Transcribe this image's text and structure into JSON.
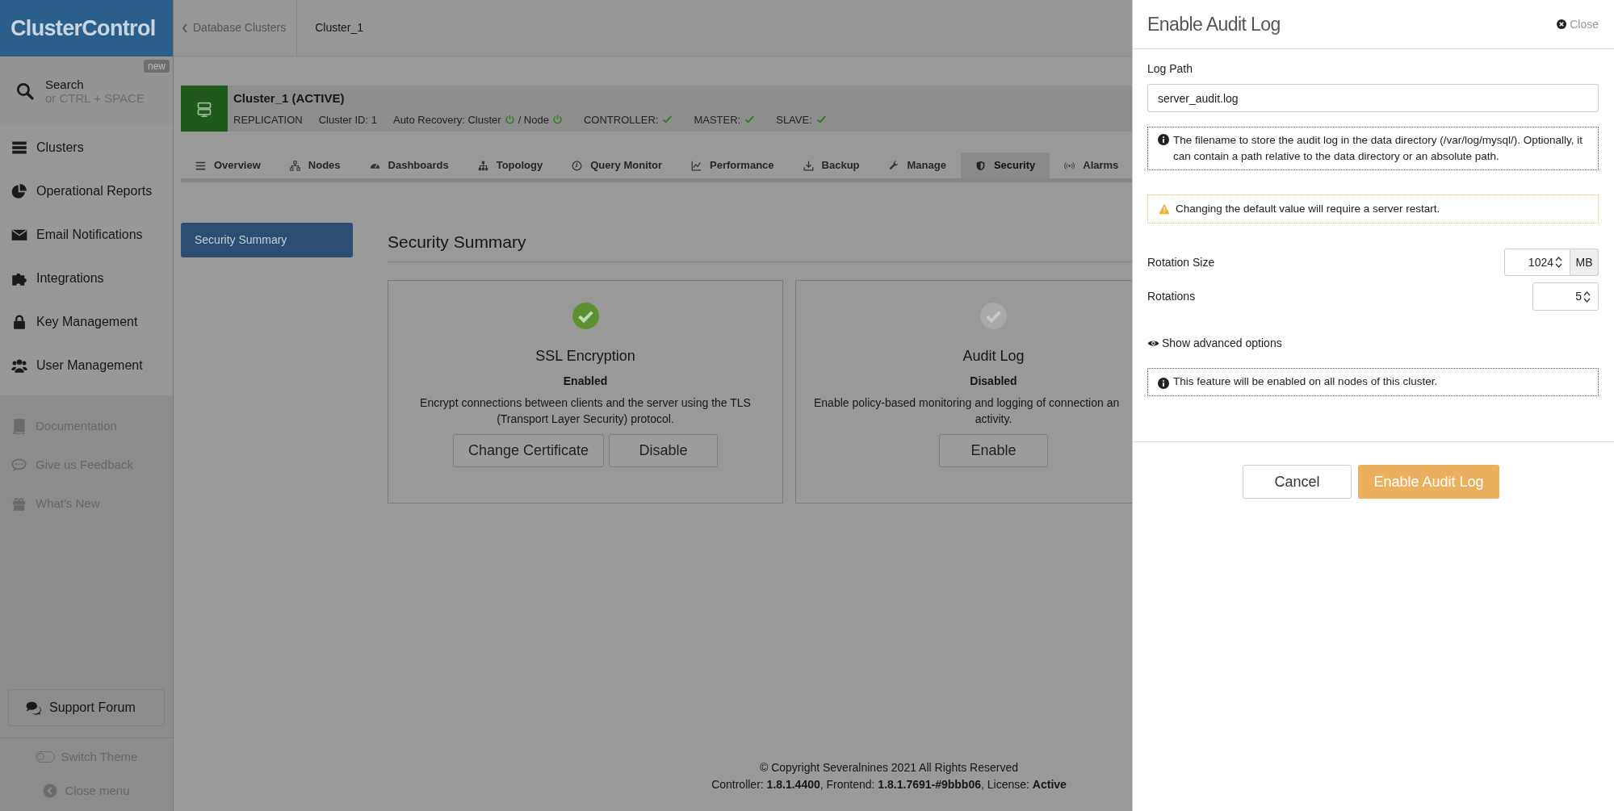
{
  "sidebar": {
    "logo": "ClusterControl",
    "search": {
      "label": "Search",
      "hint": "or CTRL + SPACE",
      "badge": "new"
    },
    "items": [
      {
        "label": "Clusters"
      },
      {
        "label": "Operational Reports"
      },
      {
        "label": "Email Notifications"
      },
      {
        "label": "Integrations"
      },
      {
        "label": "Key Management"
      },
      {
        "label": "User Management"
      }
    ],
    "links": [
      {
        "label": "Documentation"
      },
      {
        "label": "Give us Feedback"
      },
      {
        "label": "What's New"
      }
    ],
    "support": "Support Forum",
    "switch_theme": {
      "label": "Switch Theme",
      "on": false
    },
    "close_menu": "Close menu"
  },
  "breadcrumb": {
    "back": "Database Clusters",
    "current": "Cluster_1"
  },
  "cluster": {
    "title": "Cluster_1 (ACTIVE)",
    "type": "REPLICATION",
    "id": "Cluster ID: 1",
    "auto_recovery": "Auto Recovery: Cluster",
    "node": "/ Node",
    "checks": [
      {
        "label": "CONTROLLER:"
      },
      {
        "label": "MASTER:"
      },
      {
        "label": "SLAVE:"
      }
    ]
  },
  "tabs": [
    {
      "label": "Overview",
      "selected": false
    },
    {
      "label": "Nodes",
      "selected": false
    },
    {
      "label": "Dashboards",
      "selected": false
    },
    {
      "label": "Topology",
      "selected": false
    },
    {
      "label": "Query Monitor",
      "selected": false
    },
    {
      "label": "Performance",
      "selected": false
    },
    {
      "label": "Backup",
      "selected": false
    },
    {
      "label": "Manage",
      "selected": false
    },
    {
      "label": "Security",
      "selected": true
    },
    {
      "label": "Alarms",
      "selected": false
    }
  ],
  "subnav": [
    {
      "label": "Security Summary",
      "selected": true
    }
  ],
  "section_title": "Security Summary",
  "cards": [
    {
      "title": "SSL Encryption",
      "status": "Enabled",
      "enabled": true,
      "description": [
        "Encrypt connections between clients and the server using the TLS",
        "(Transport Layer Security) protocol."
      ],
      "buttons": [
        "Change Certificate",
        "Disable"
      ]
    },
    {
      "title": "Audit Log",
      "status": "Disabled",
      "enabled": false,
      "description": [
        "Enable policy-based monitoring and logging of connection an",
        "activity."
      ],
      "buttons": [
        "Enable"
      ]
    }
  ],
  "footer": {
    "copyright": "© Copyright Severalnines 2021 All Rights Reserved",
    "versions": "Controller: **1.8.1.4400**, Frontend: **1.8.1.7691-#9bbb06**, License: **Active**"
  },
  "panel": {
    "title": "Enable Audit Log",
    "close": "Close",
    "log_path": {
      "label": "Log Path",
      "value": "server_audit.log"
    },
    "info": "The filename to store the audit log in the data directory (/var/log/mysql/). Optionally, it can contain a path relative to the data directory or an absolute path.",
    "warning": "Changing the default value will require a server restart.",
    "rotation_size": {
      "label": "Rotation Size",
      "value": "1024",
      "unit": "MB"
    },
    "rotations": {
      "label": "Rotations",
      "value": "5"
    },
    "advanced": "Show advanced options",
    "note": "This feature will be enabled on all nodes of this cluster.",
    "buttons": {
      "cancel": "Cancel",
      "confirm": "Enable Audit Log"
    }
  }
}
